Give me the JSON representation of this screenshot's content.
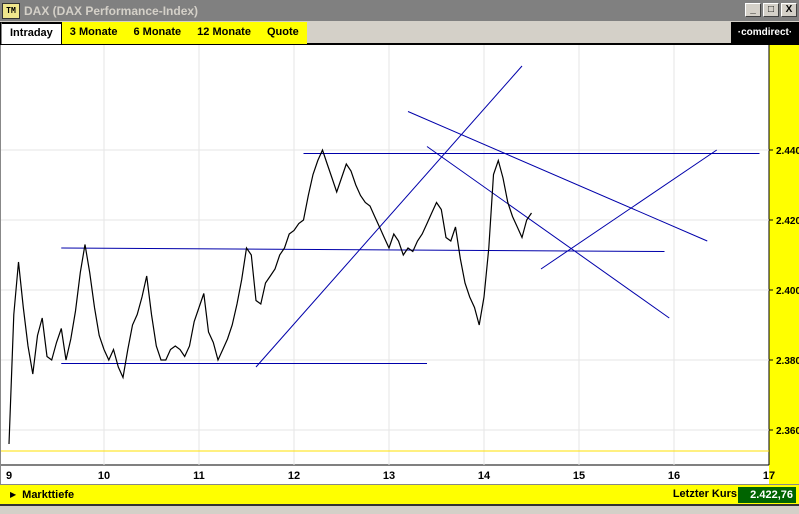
{
  "window": {
    "title": "DAX (DAX Performance-Index)",
    "icon_label": "TM",
    "buttons": [
      "_",
      "□",
      "X"
    ]
  },
  "tabs": [
    {
      "label": "Intraday",
      "active": true
    },
    {
      "label": "3 Monate",
      "active": false
    },
    {
      "label": "6 Monate",
      "active": false
    },
    {
      "label": "12 Monate",
      "active": false
    },
    {
      "label": "Quote",
      "active": false
    }
  ],
  "logo": "·comdirect·",
  "footer": {
    "markttiefe": "Markttiefe",
    "letzter_kurs_label": "Letzter Kurs",
    "letzter_kurs_value": "2.422,76"
  },
  "colors": {
    "accent": "#ffff00",
    "price_line": "#000000",
    "trend_line": "#0000aa",
    "reference_line": "#ffe000",
    "value_bg": "#006400"
  },
  "chart_data": {
    "type": "line",
    "x_labels": [
      "9",
      "10",
      "11",
      "12",
      "13",
      "14",
      "15",
      "16",
      "17"
    ],
    "x": [
      9,
      9.05,
      9.1,
      9.15,
      9.2,
      9.25,
      9.3,
      9.35,
      9.4,
      9.45,
      9.5,
      9.55,
      9.6,
      9.65,
      9.7,
      9.75,
      9.8,
      9.85,
      9.9,
      9.95,
      10,
      10.05,
      10.1,
      10.15,
      10.2,
      10.25,
      10.3,
      10.35,
      10.4,
      10.45,
      10.5,
      10.55,
      10.6,
      10.65,
      10.7,
      10.75,
      10.8,
      10.85,
      10.9,
      10.95,
      11,
      11.05,
      11.1,
      11.15,
      11.2,
      11.25,
      11.3,
      11.35,
      11.4,
      11.45,
      11.5,
      11.55,
      11.6,
      11.65,
      11.7,
      11.75,
      11.8,
      11.85,
      11.9,
      11.95,
      12,
      12.05,
      12.1,
      12.15,
      12.2,
      12.25,
      12.3,
      12.35,
      12.4,
      12.45,
      12.5,
      12.55,
      12.6,
      12.65,
      12.7,
      12.75,
      12.8,
      12.85,
      12.9,
      12.95,
      13,
      13.05,
      13.1,
      13.15,
      13.2,
      13.25,
      13.3,
      13.35,
      13.4,
      13.45,
      13.5,
      13.55,
      13.6,
      13.65,
      13.7,
      13.75,
      13.8,
      13.85,
      13.9,
      13.95,
      14,
      14.05,
      14.1,
      14.15,
      14.2,
      14.25,
      14.3,
      14.35,
      14.4,
      14.45,
      14.5,
      14.55,
      14.6,
      14.65,
      14.7,
      14.75,
      14.8,
      14.85,
      14.9,
      14.95,
      15,
      15.05,
      15.1,
      15.15,
      15.2,
      15.25,
      15.3,
      15.35,
      15.4,
      15.45,
      15.5,
      15.55,
      15.6,
      15.65,
      15.7,
      15.75,
      15.8,
      15.85,
      15.9,
      15.95,
      16,
      16.05,
      16.1,
      16.15,
      16.2,
      16.25,
      16.3,
      16.35,
      16.4
    ],
    "y": [
      2356,
      2393,
      2408,
      2395,
      2384,
      2376,
      2387,
      2392,
      2381,
      2380,
      2385,
      2389,
      2380,
      2386,
      2394,
      2405,
      2413,
      2405,
      2395,
      2387,
      2383,
      2380,
      2383,
      2378,
      2375,
      2383,
      2390,
      2393,
      2398,
      2404,
      2393,
      2384,
      2380,
      2380,
      2383,
      2384,
      2383,
      2381,
      2384,
      2391,
      2395,
      2399,
      2388,
      2385,
      2380,
      2383,
      2386,
      2390,
      2396,
      2403,
      2412,
      2410,
      2397,
      2396,
      2402,
      2404,
      2406,
      2410,
      2412,
      2416,
      2417,
      2419,
      2420,
      2427,
      2433,
      2437,
      2440,
      2436,
      2432,
      2428,
      2432,
      2436,
      2434,
      2430,
      2427,
      2425,
      2424,
      2421,
      2418,
      2415,
      2412,
      2416,
      2414,
      2410,
      2412,
      2411,
      2414,
      2416,
      2419,
      2422,
      2425,
      2423,
      2415,
      2414,
      2418,
      2409,
      2402,
      2398,
      2395,
      2390,
      2398,
      2412,
      2433,
      2437,
      2432,
      2425,
      2421,
      2418,
      2415,
      2420,
      2422
    ],
    "ylim": [
      2350,
      2470
    ],
    "y_ticks": [
      "2.440",
      "2.420",
      "2.400",
      "2.380",
      "2.360"
    ],
    "grid": true,
    "reference_line_y": 2354
  }
}
